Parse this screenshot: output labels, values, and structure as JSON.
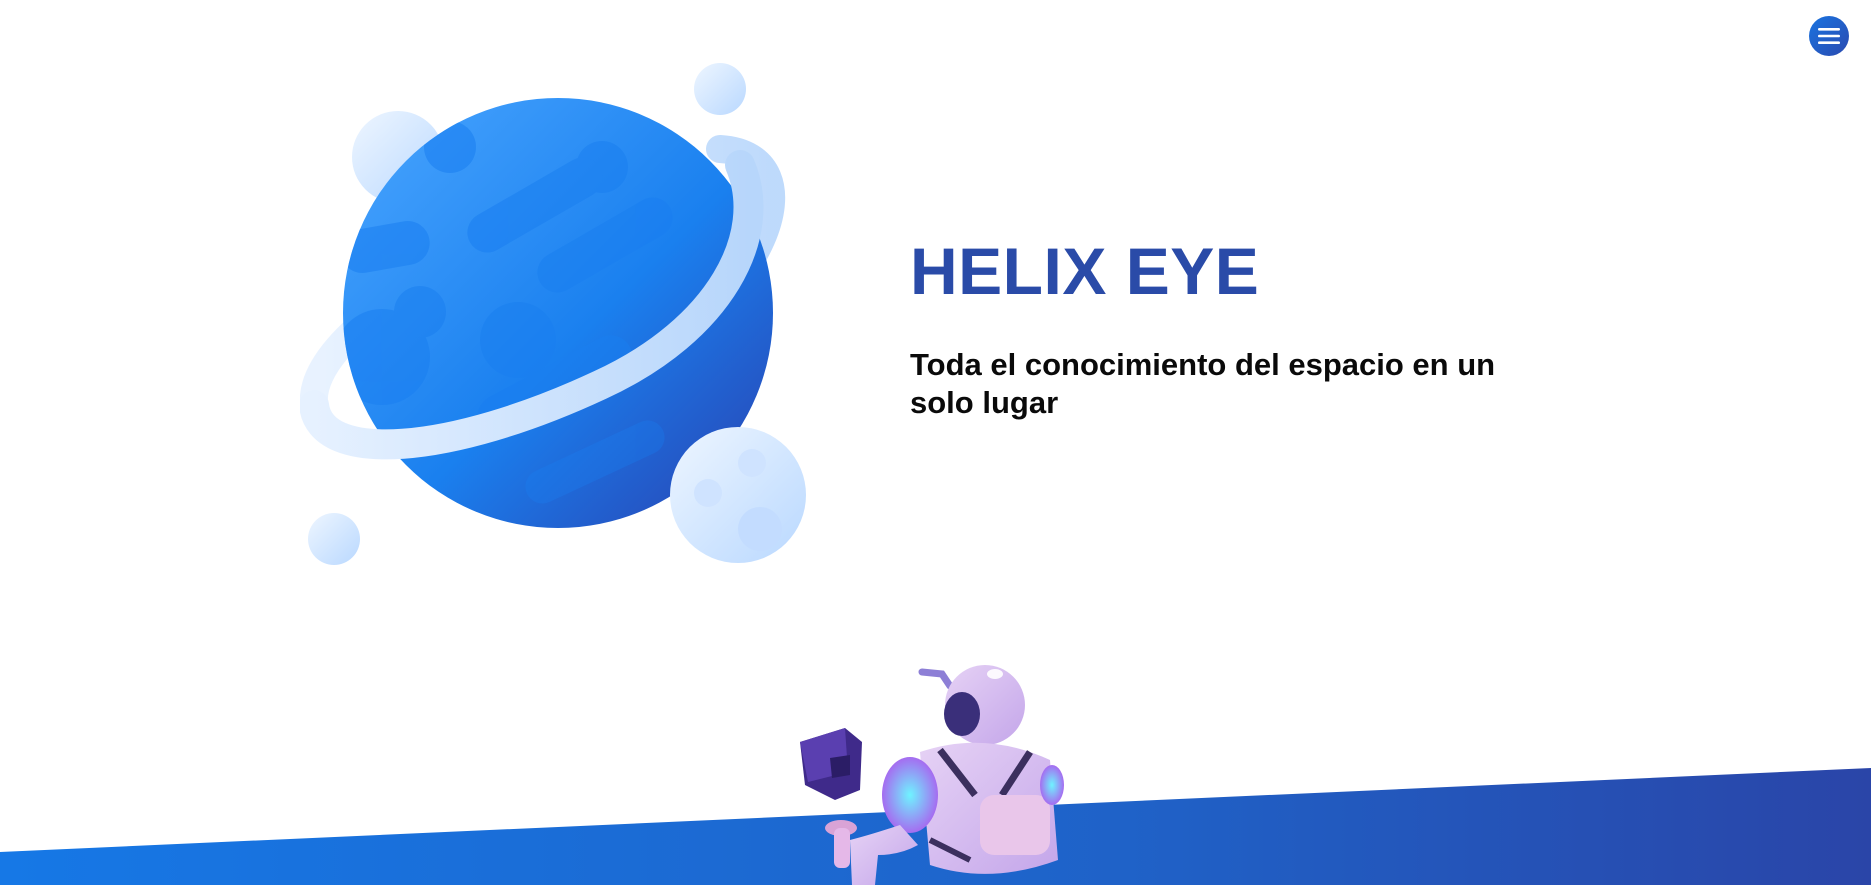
{
  "header": {
    "menu_icon": "hamburger-menu-icon"
  },
  "hero": {
    "title": "HELIX EYE",
    "subtitle": "Toda el conocimiento del espacio en un solo lugar",
    "illustration_icon": "planet-illustration-icon",
    "figure_icon": "astronaut-illustration-icon"
  },
  "colors": {
    "brand_blue": "#2a4ba8",
    "accent_blue": "#1a74e0",
    "planet_light": "#dcecff",
    "background": "#ffffff",
    "text_dark": "#0a0a0a"
  }
}
